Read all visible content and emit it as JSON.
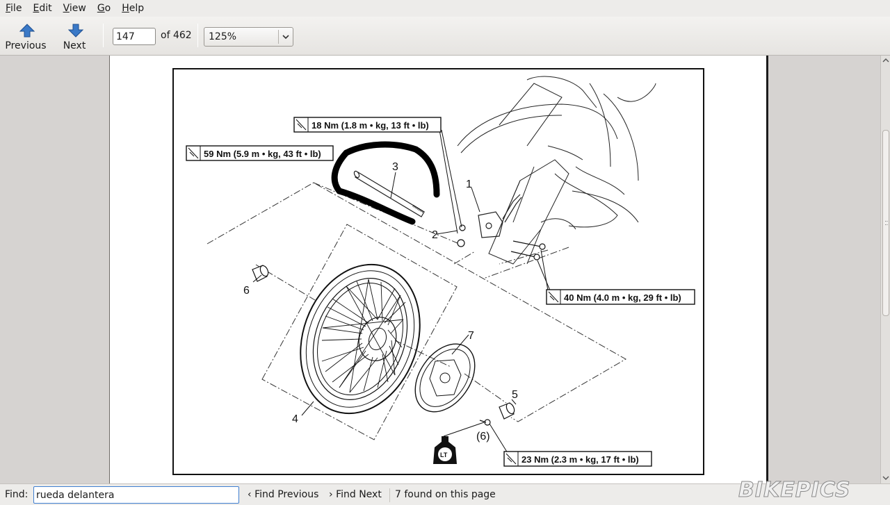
{
  "menubar": {
    "items": [
      {
        "accel": "F",
        "rest": "ile"
      },
      {
        "accel": "E",
        "rest": "dit"
      },
      {
        "accel": "V",
        "rest": "iew"
      },
      {
        "accel": "G",
        "rest": "o"
      },
      {
        "accel": "H",
        "rest": "elp"
      }
    ]
  },
  "toolbar": {
    "previous_label": "Previous",
    "next_label": "Next",
    "page_value": "147",
    "page_total": "of 462",
    "zoom_value": "125%"
  },
  "diagram": {
    "callouts": {
      "c1": "1",
      "c2": "2",
      "c3": "3",
      "c4": "4",
      "c5": "5",
      "c6": "6",
      "c7": "7",
      "c6b": "(6)"
    },
    "torques": {
      "t18": "18 Nm (1.8 m • kg, 13 ft • lb)",
      "t59": "59 Nm (5.9 m • kg, 43 ft • lb)",
      "t40": "40 Nm (4.0 m • kg, 29 ft • lb)",
      "t23": "23 Nm (2.3 m • kg, 17 ft • lb)"
    },
    "lt_label": "LT"
  },
  "findbar": {
    "label": "Find:",
    "value": "rueda delantera",
    "find_previous": "Find Previous",
    "find_next": "Find Next",
    "status": "7 found on this page"
  },
  "watermark": "BIKEPICS",
  "colors": {
    "accent_blue": "#3f7ed0",
    "arrow_blue": "#3a79c7"
  }
}
